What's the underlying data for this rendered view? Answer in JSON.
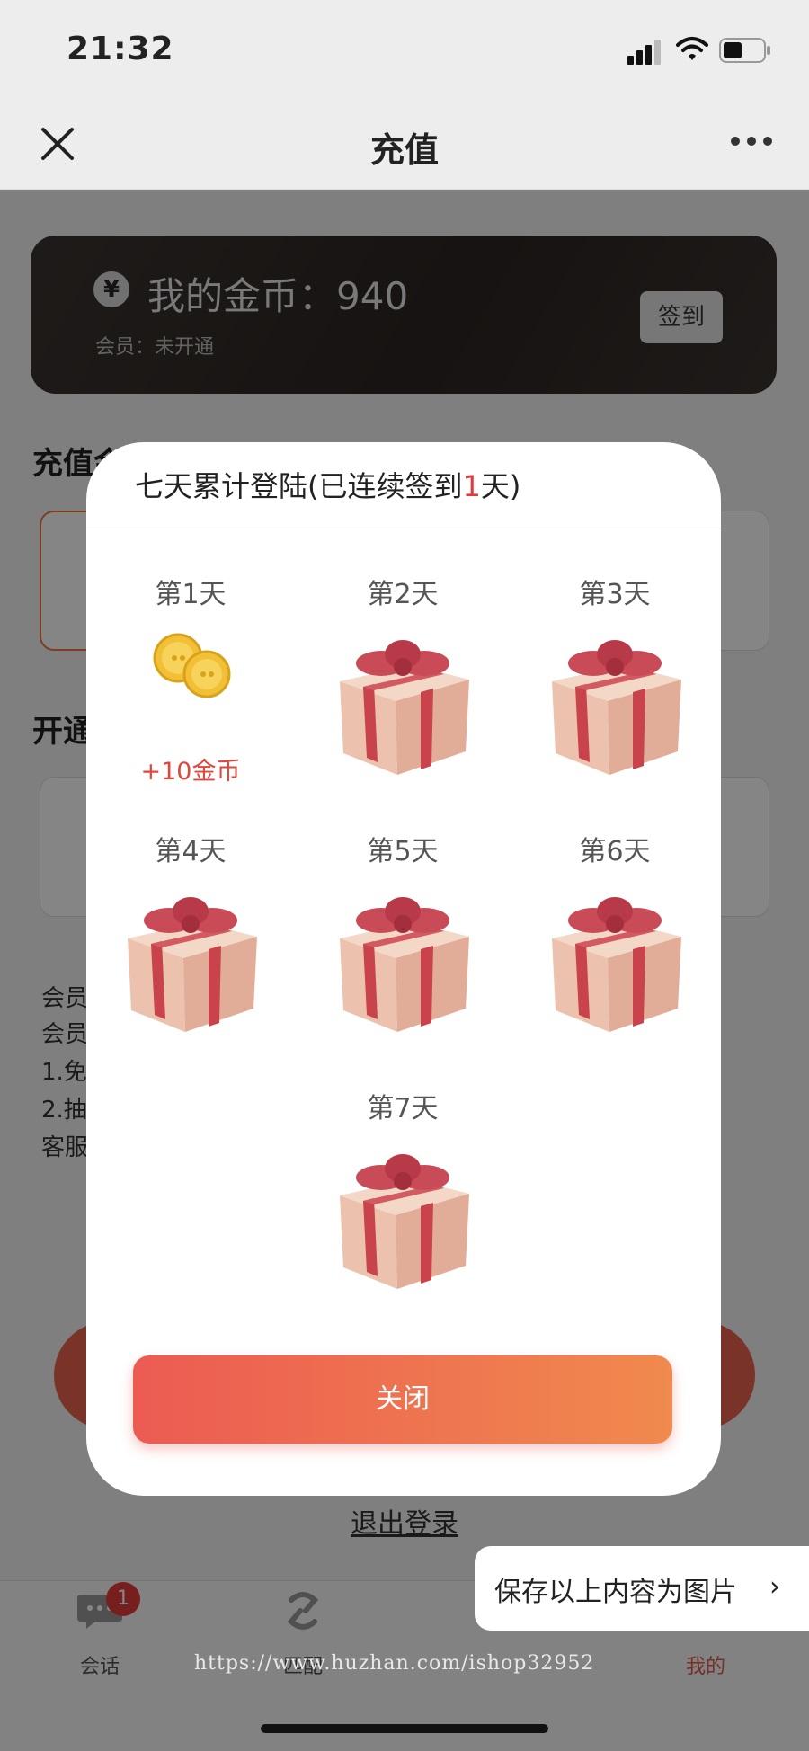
{
  "status_bar": {
    "time": "21:32"
  },
  "nav": {
    "title": "充值"
  },
  "coin_card": {
    "coins_text": "我的金币：940",
    "member_text": "会员：未开通",
    "signin_label": "签到",
    "currency_symbol": "¥"
  },
  "sections": {
    "recharge_title": "充值金",
    "open_title": "开通",
    "member_lines": [
      "会员",
      "会员",
      "1.免",
      "2.抽",
      "客服"
    ],
    "logout_label": "退出登录"
  },
  "tabbar": {
    "badge": "1",
    "tabs": [
      {
        "label": "会话",
        "icon": "chat-icon"
      },
      {
        "label": "匹配",
        "icon": "match-icon"
      },
      {
        "label": "",
        "icon": "discover-icon"
      },
      {
        "label": "我的",
        "icon": "profile-icon"
      }
    ]
  },
  "modal": {
    "title_prefix": "七天累计登陆(已连续签到",
    "title_count": "1",
    "title_suffix": "天)",
    "days": [
      {
        "label": "第1天",
        "reward": "+10金币",
        "claimed": true
      },
      {
        "label": "第2天"
      },
      {
        "label": "第3天"
      },
      {
        "label": "第4天"
      },
      {
        "label": "第5天"
      },
      {
        "label": "第6天"
      },
      {
        "label": "第7天"
      }
    ],
    "close_label": "关闭"
  },
  "save_popup": {
    "label": "保存以上内容为图片",
    "chevron": "›"
  },
  "watermark": "https://www.huzhan.com/ishop32952",
  "colors": {
    "accent_red": "#e23b3b",
    "button_start": "#ec5b52",
    "button_end": "#f08a4e",
    "card_dark": "#2b2523"
  }
}
